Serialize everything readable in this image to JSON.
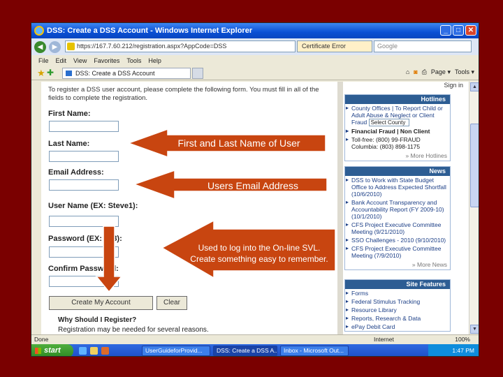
{
  "window": {
    "title": "DSS: Create a DSS Account - Windows Internet Explorer",
    "min": "_",
    "max": "□",
    "close": "✕"
  },
  "addressbar": {
    "back": "◀",
    "forward": "▶",
    "url": "https://167.7.60.212/registration.aspx?AppCode=DSS",
    "cert": "Certificate Error",
    "search_placeholder": "Google"
  },
  "menu": [
    "File",
    "Edit",
    "View",
    "Favorites",
    "Tools",
    "Help"
  ],
  "favbar": {
    "star": "★",
    "add": "✚",
    "tab": "DSS: Create a DSS Account",
    "page": "Page ▾",
    "tools": "Tools ▾"
  },
  "form": {
    "intro": "To register a DSS user account, please complete the following form. You must fill in all of the fields to complete the registration.",
    "first_name": "First Name:",
    "last_name": "Last Name:",
    "email": "Email Address:",
    "username": "User Name (EX: Steve1):",
    "password": "Password (EX: 123):",
    "confirm": "Confirm Password:",
    "create_button": "Create My Account",
    "clear_button": "Clear",
    "why_title": "Why Should I Register?",
    "why_text": "Registration may be needed for several reasons."
  },
  "sidebar": {
    "signin": "Sign in",
    "hotlines_title": "Hotlines",
    "hotline_items": [
      "County Offices | To Report Child or Adult Abuse & Neglect or Client Fraud",
      "Financial Fraud | Non Client",
      "Toll-free: (800) 99-FRAUD Columbia: (803) 898-1175"
    ],
    "county_select": "Select County",
    "more_hotlines": "» More Hotlines",
    "news_title": "News",
    "news_items": [
      "DSS to Work with State Budget Office to Address Expected Shortfall (10/6/2010)",
      "Bank Account Transparency and Accountability Report (FY 2009-10) (10/1/2010)",
      "CFS Project Executive Committee Meeting (9/21/2010)",
      "SSO Challenges - 2010 (9/10/2010)",
      "CFS Project Executive Committee Meeting (7/9/2010)"
    ],
    "more_news": "» More News",
    "features_title": "Site Features",
    "feature_items": [
      "Forms",
      "Federal Stimulus Tracking",
      "Resource Library",
      "Reports, Research & Data",
      "ePay Debit Card"
    ]
  },
  "status": {
    "left": "Done",
    "zone": "Internet",
    "zoom": "100%"
  },
  "taskbar": {
    "start": "start",
    "tasks": [
      "UserGuideforProvid...",
      "DSS: Create a DSS A...",
      "Inbox - Microsoft Out..."
    ],
    "clock": "1:47 PM"
  },
  "annotations": {
    "name_note": "First and Last Name of User",
    "email_note": "Users Email Address",
    "password_note_line1": "Used to log into the On-line SVL.",
    "password_note_line2": "Create something easy to remember."
  },
  "colors": {
    "slide_background": "#7a0000",
    "arrow_fill": "#c84510",
    "arrow_stroke": "#ffffff",
    "sidebar_header": "#2d5d93"
  }
}
